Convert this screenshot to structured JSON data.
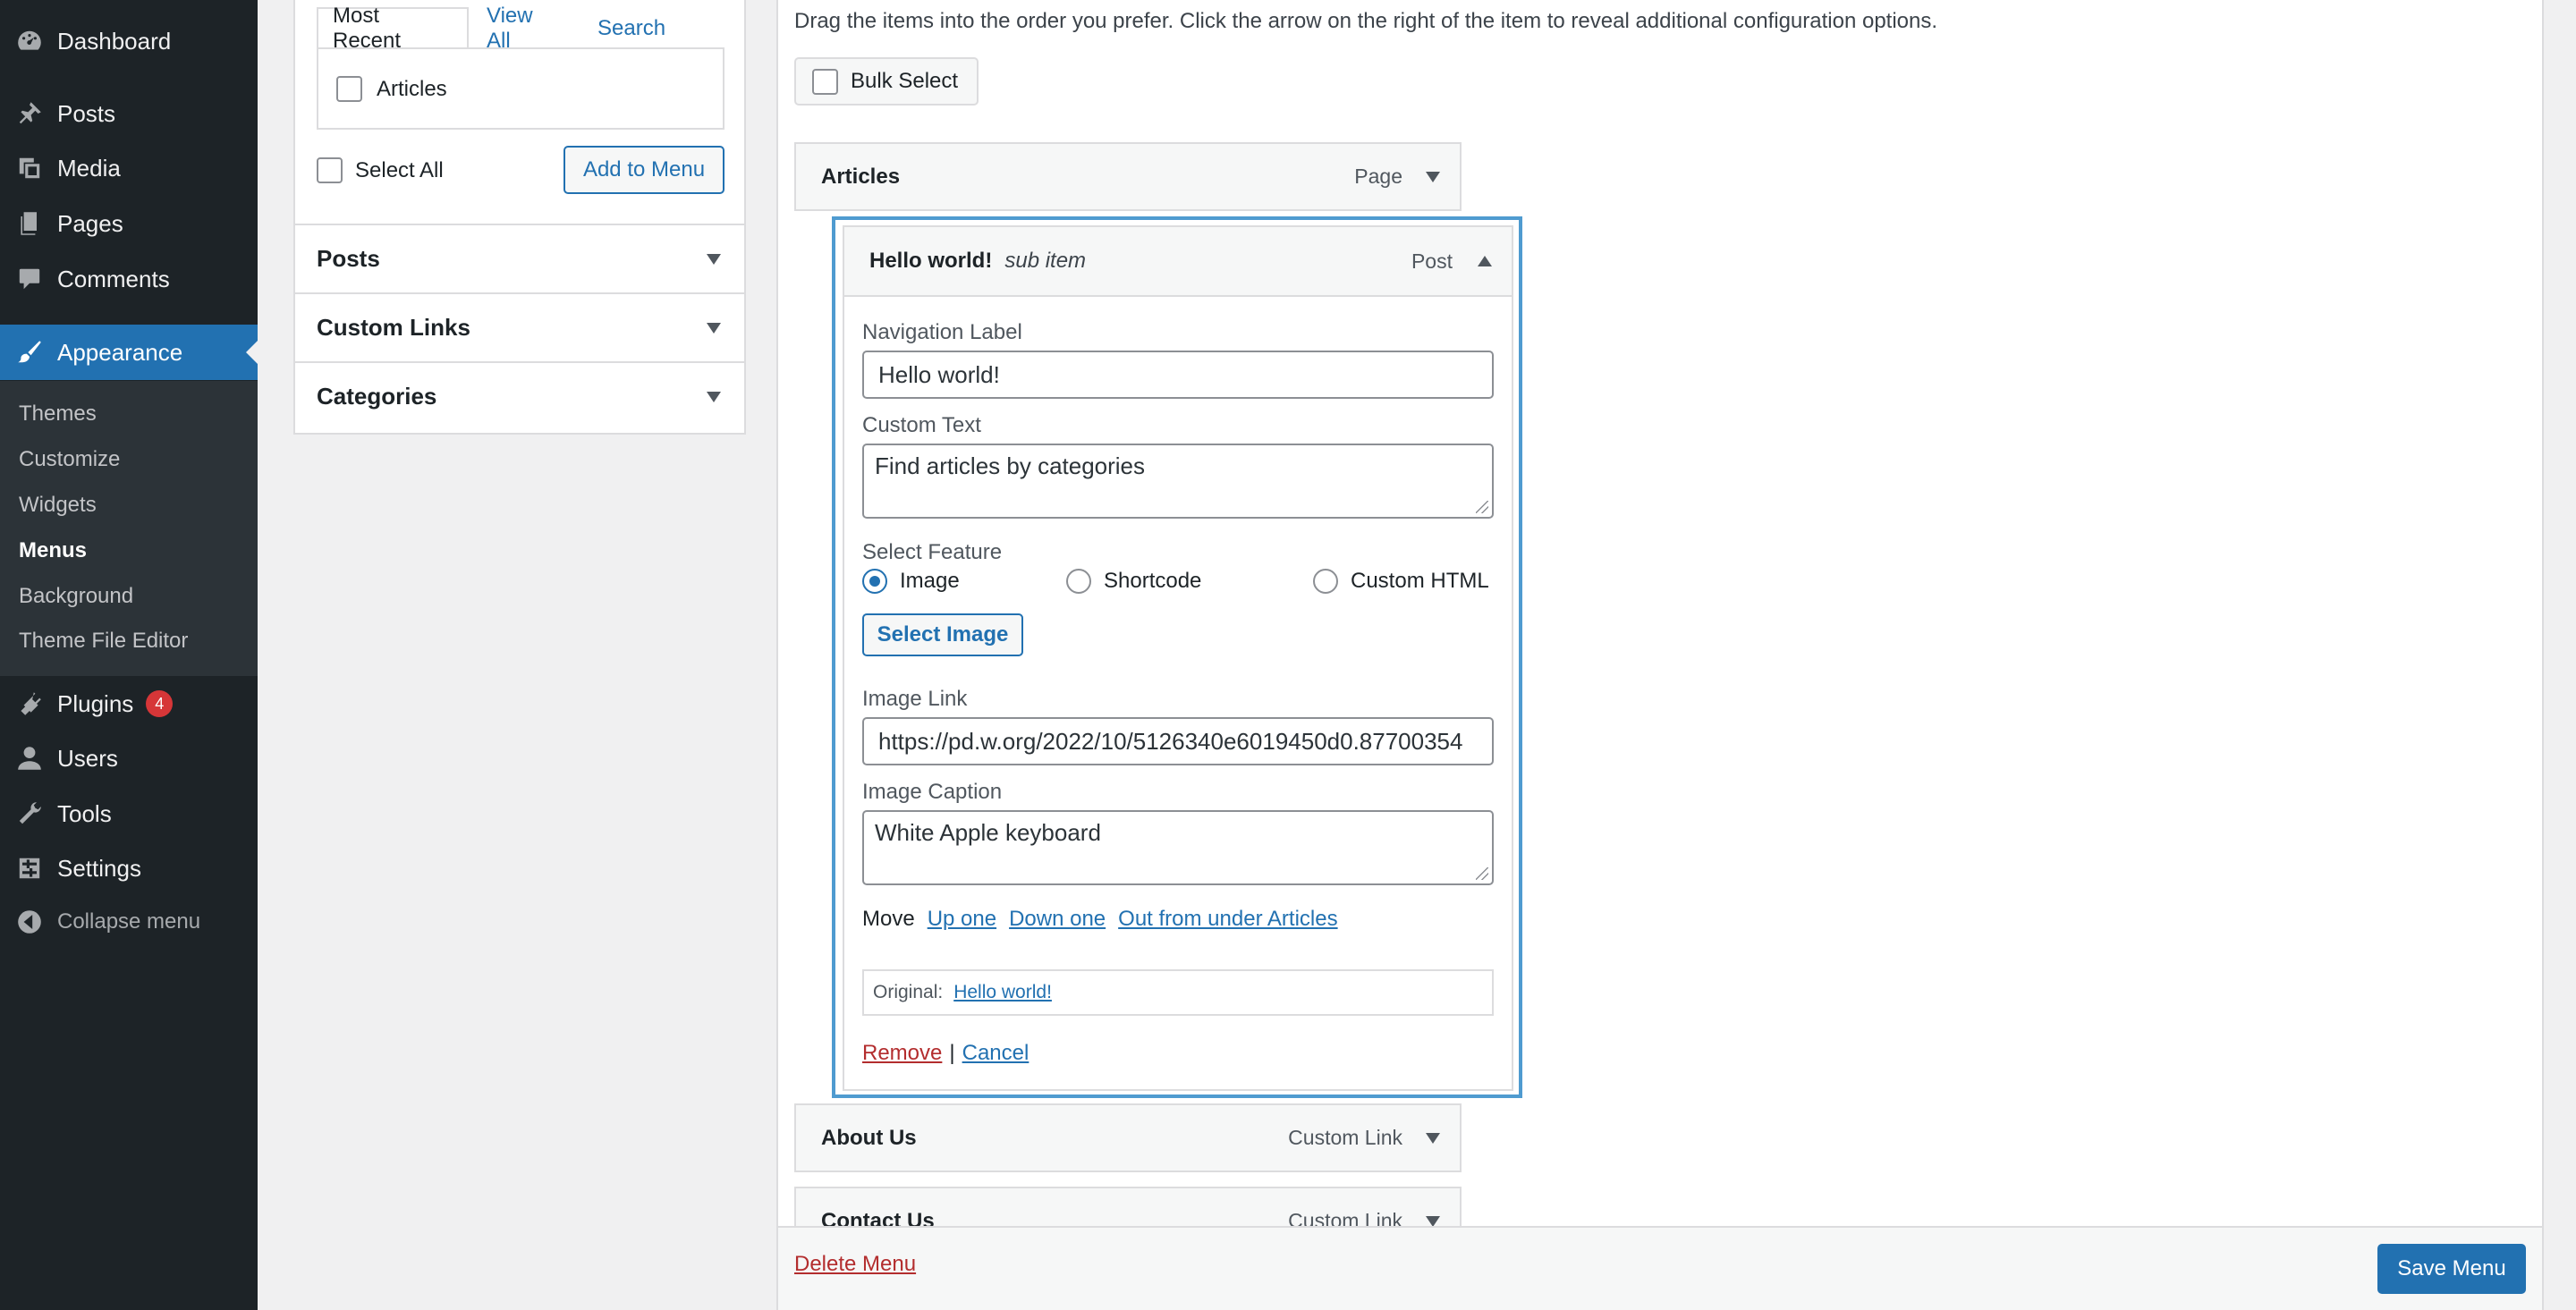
{
  "sidebar": {
    "items": [
      {
        "label": "Dashboard",
        "icon": "dashboard-icon"
      },
      {
        "label": "Posts",
        "icon": "pin-icon"
      },
      {
        "label": "Media",
        "icon": "media-icon"
      },
      {
        "label": "Pages",
        "icon": "pages-icon"
      },
      {
        "label": "Comments",
        "icon": "comment-icon"
      },
      {
        "label": "Appearance",
        "icon": "brush-icon"
      },
      {
        "label": "Plugins",
        "icon": "plugin-icon",
        "badge": "4"
      },
      {
        "label": "Users",
        "icon": "user-icon"
      },
      {
        "label": "Tools",
        "icon": "wrench-icon"
      },
      {
        "label": "Settings",
        "icon": "settings-icon"
      },
      {
        "label": "Collapse menu",
        "icon": "collapse-icon"
      }
    ],
    "submenu": [
      "Themes",
      "Customize",
      "Widgets",
      "Menus",
      "Background",
      "Theme File Editor"
    ]
  },
  "add_items": {
    "tabs": [
      "Most Recent",
      "View All",
      "Search"
    ],
    "recent_item": "Articles",
    "select_all": "Select All",
    "add_button": "Add to Menu",
    "sections": [
      "Posts",
      "Custom Links",
      "Categories"
    ]
  },
  "structure": {
    "instructions": "Drag the items into the order you prefer. Click the arrow on the right of the item to reveal additional configuration options.",
    "bulk_select": "Bulk Select",
    "items": [
      {
        "title": "Articles",
        "type": "Page"
      },
      {
        "title": "About Us",
        "type": "Custom Link"
      },
      {
        "title": "Contact Us",
        "type": "Custom Link"
      }
    ],
    "expanded": {
      "title": "Hello world!",
      "note": "sub item",
      "type": "Post",
      "nav_label_label": "Navigation Label",
      "nav_label_value": "Hello world!",
      "custom_text_label": "Custom Text",
      "custom_text_value": "Find articles by categories",
      "feature_label": "Select Feature",
      "feature_options": [
        "Image",
        "Shortcode",
        "Custom HTML"
      ],
      "feature_selected": "Image",
      "select_image_button": "Select Image",
      "image_link_label": "Image Link",
      "image_link_value": "https://pd.w.org/2022/10/5126340e6019450d0.87700354",
      "image_caption_label": "Image Caption",
      "image_caption_value": "White Apple keyboard",
      "move_label": "Move",
      "move_links": [
        "Up one",
        "Down one",
        "Out from under Articles"
      ],
      "original_label": "Original:",
      "original_link": "Hello world!",
      "remove": "Remove",
      "separator": "|",
      "cancel": "Cancel"
    }
  },
  "footer": {
    "delete": "Delete Menu",
    "save": "Save Menu"
  },
  "colors": {
    "admin_bg": "#1d2327",
    "accent": "#2271b1",
    "focus_outline": "#4f9bd0",
    "danger": "#b32d2e"
  }
}
